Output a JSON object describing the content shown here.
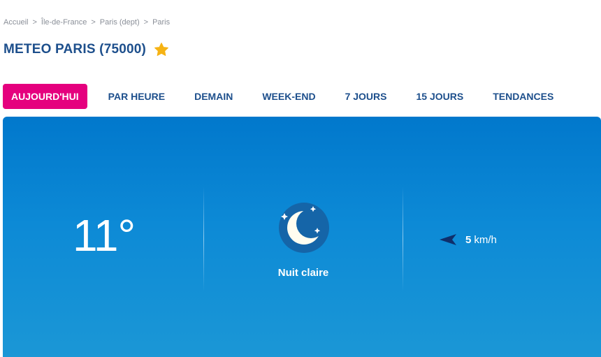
{
  "breadcrumb": {
    "items": [
      "Accueil",
      "Île-de-France",
      "Paris (dept)",
      "Paris"
    ],
    "separator": ">"
  },
  "header": {
    "title": "METEO PARIS (75000)",
    "favorite_icon": "star-icon",
    "favorite_color": "#f6b314"
  },
  "tabs": [
    {
      "label": "AUJOURD'HUI",
      "active": true
    },
    {
      "label": "PAR HEURE",
      "active": false
    },
    {
      "label": "DEMAIN",
      "active": false
    },
    {
      "label": "WEEK-END",
      "active": false
    },
    {
      "label": "7 JOURS",
      "active": false
    },
    {
      "label": "15 JOURS",
      "active": false
    },
    {
      "label": "TENDANCES",
      "active": false
    }
  ],
  "weather": {
    "temperature": "11°",
    "condition": "Nuit claire",
    "condition_icon": "moon-stars-icon",
    "wind_speed": "5",
    "wind_unit": "km/h",
    "wind_icon": "wind-direction-arrow-icon"
  },
  "colors": {
    "accent": "#e5007e",
    "brand": "#1d4f8c",
    "panel_top": "#0178cc",
    "panel_bottom": "#1b97d6"
  }
}
